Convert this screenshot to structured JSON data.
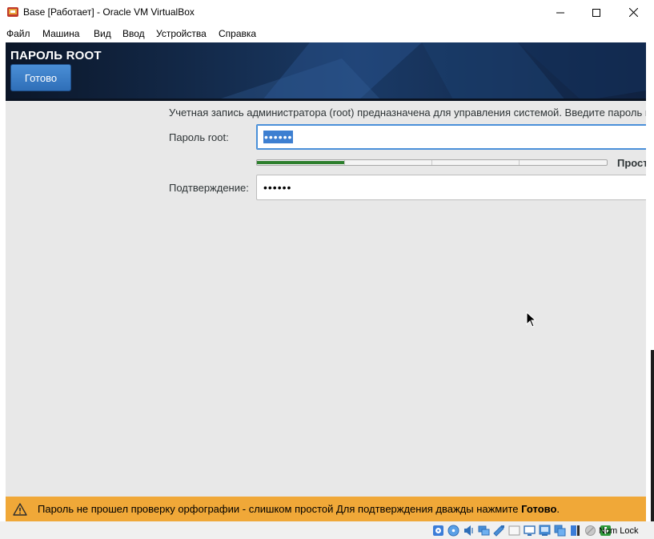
{
  "window": {
    "title": "Base [Работает] - Oracle VM VirtualBox",
    "app_icon": "virtualbox-icon",
    "controls": [
      "minimize-icon",
      "maximize-icon",
      "close-icon"
    ]
  },
  "menubar": {
    "items": [
      {
        "label": "Файл"
      },
      {
        "label": "Машина"
      },
      {
        "label": "Вид"
      },
      {
        "label": "Ввод"
      },
      {
        "label": "Устройства"
      },
      {
        "label": "Справка"
      }
    ]
  },
  "installer": {
    "title": "ПАРОЛЬ ROOT",
    "done_label": "Готово",
    "description": "Учетная запись администратора (root) предназначена для управления системой. Введите пароль г",
    "password_label": "Пароль root:",
    "password_value": "••••••",
    "confirm_label": "Подтверждение:",
    "confirm_value": "••••••",
    "strength": {
      "label": "Прост",
      "fraction": 0.25,
      "color": "#2d7f2d"
    },
    "warning": {
      "text": "Пароль не прошел проверку орфографии - слишком простой Для подтверждения дважды нажмите ",
      "emphasis": "Готово",
      "suffix": ".",
      "icon": "warning-icon",
      "color": "#f0a838"
    }
  },
  "statusbar": {
    "icons": [
      "hard-disk-icon",
      "optical-disk-icon",
      "audio-icon",
      "network-icon",
      "usb-icon",
      "shared-folder-icon",
      "display-icon",
      "video-capture-icon",
      "cpu-icon",
      "mouse-integration-icon",
      "keyboard-capture-icon"
    ],
    "numlock": "Num Lock"
  },
  "colors": {
    "accent": "#2f6fb8",
    "header_bg": "#0e1a2d",
    "screen_bg": "#e8e8e8"
  }
}
